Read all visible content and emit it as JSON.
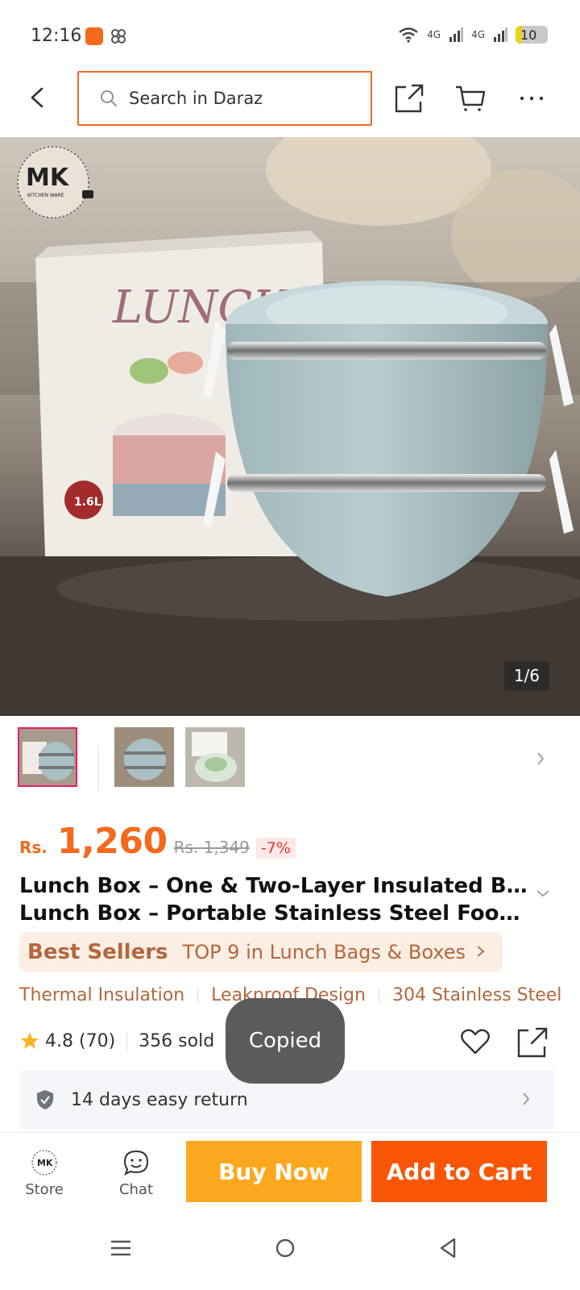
{
  "status_bar": {
    "time": "12:16",
    "network_1": "4G",
    "network_2": "4G",
    "battery": "10"
  },
  "search": {
    "placeholder": "Search in Daraz"
  },
  "gallery": {
    "counter": "1/6",
    "logo_text": "MK",
    "logo_subtext": "KITCHEN WARE",
    "box_label": "LUNCH",
    "capacity_badge": "1.6L"
  },
  "price": {
    "currency": "Rs.",
    "current": "1,260",
    "original": "Rs. 1,349",
    "discount": "-7%"
  },
  "product": {
    "title_line1": "Lunch Box – One & Two-Layer Insulated Bento",
    "title_line2": "Lunch Box – Portable Stainless Steel Food Co..."
  },
  "best_sellers": {
    "label": "Best Sellers",
    "text": "TOP 9 in Lunch Bags & Boxes"
  },
  "tags": [
    "Thermal Insulation",
    "Leakproof Design",
    "304 Stainless Steel"
  ],
  "rating": {
    "score": "4.8",
    "count": "(70)",
    "sold": "356 sold"
  },
  "toast": "Copied",
  "return_policy": "14 days easy return",
  "bottom_bar": {
    "store_label": "Store",
    "store_logo": "MK",
    "chat_label": "Chat",
    "buy_now": "Buy Now",
    "add_to_cart": "Add to Cart"
  },
  "colors": {
    "accent": "#f36a1d",
    "buy_now": "#fca81e",
    "add_to_cart": "#f85606",
    "best_seller_bg": "#fdeee4",
    "best_seller_text": "#b2673c"
  }
}
